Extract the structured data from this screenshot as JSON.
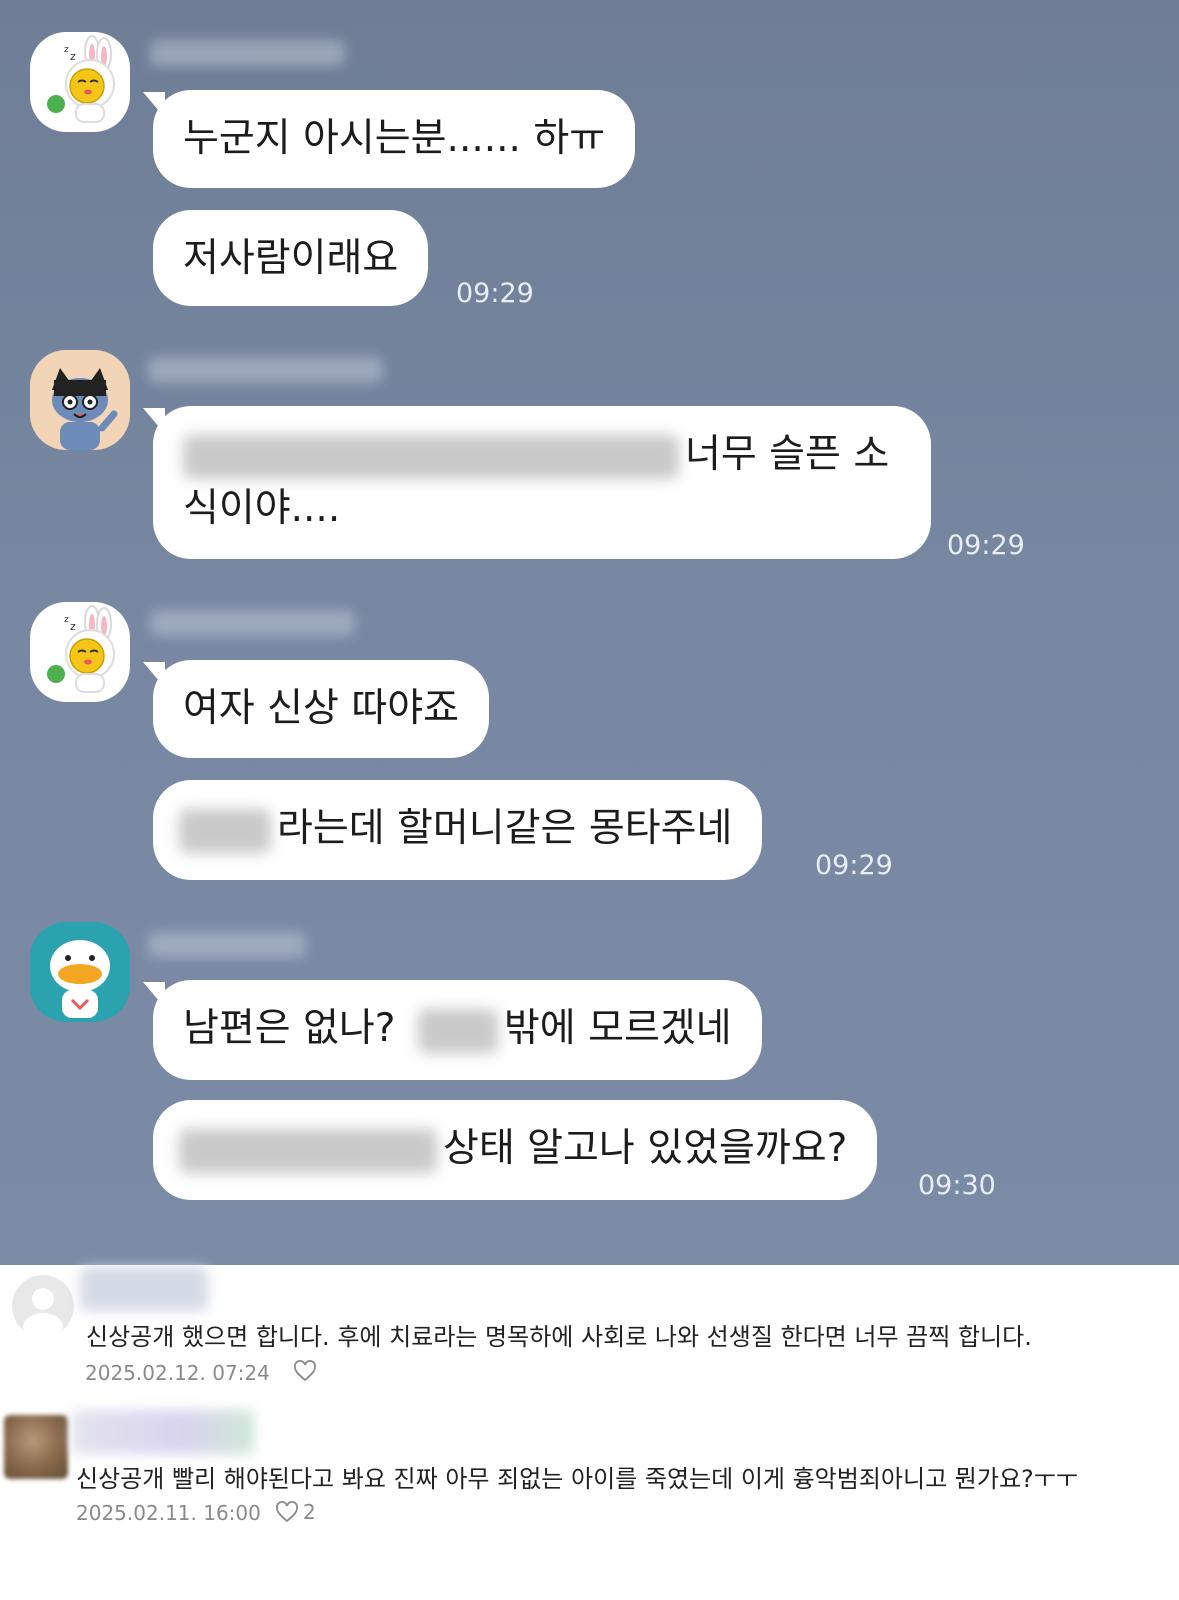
{
  "chat": {
    "messages": [
      {
        "text": "누군지 아시는분...... 하ㅠ"
      },
      {
        "text": "저사람이래요",
        "time": "09:29"
      },
      {
        "text": "너무 슬픈 소식이야....",
        "time": "09:29"
      },
      {
        "text": "여자 신상 따야죠"
      },
      {
        "text": "라는데 할머니같은 몽타주네",
        "time": "09:29"
      },
      {
        "text": "남편은 없나?",
        "text2": "밖에 모르겠네"
      },
      {
        "text": "상태 알고나 있었을까요?",
        "time": "09:30"
      }
    ],
    "avatars": [
      "sleeping-rabbit-character-icon",
      "cat-character-icon",
      "sleeping-rabbit-character-icon",
      "duck-character-icon"
    ],
    "colors": {
      "background": "#7585a0",
      "bubble": "#ffffff",
      "time": "#e8ecf3"
    }
  },
  "comments": [
    {
      "text": "신상공개 했으면 합니다. 후에 치료라는 명목하에 사회로 나와 선생질 한다면 너무 끔찍 합니다.",
      "date": "2025.02.12. 07:24",
      "likes": ""
    },
    {
      "text": "신상공개 빨리 해야된다고 봐요 진짜 아무 죄없는 아이를 죽였는데 이게 흉악범죄아니고 뭔가요?ㅜㅜ",
      "date": "2025.02.11. 16:00",
      "likes": "2"
    }
  ]
}
